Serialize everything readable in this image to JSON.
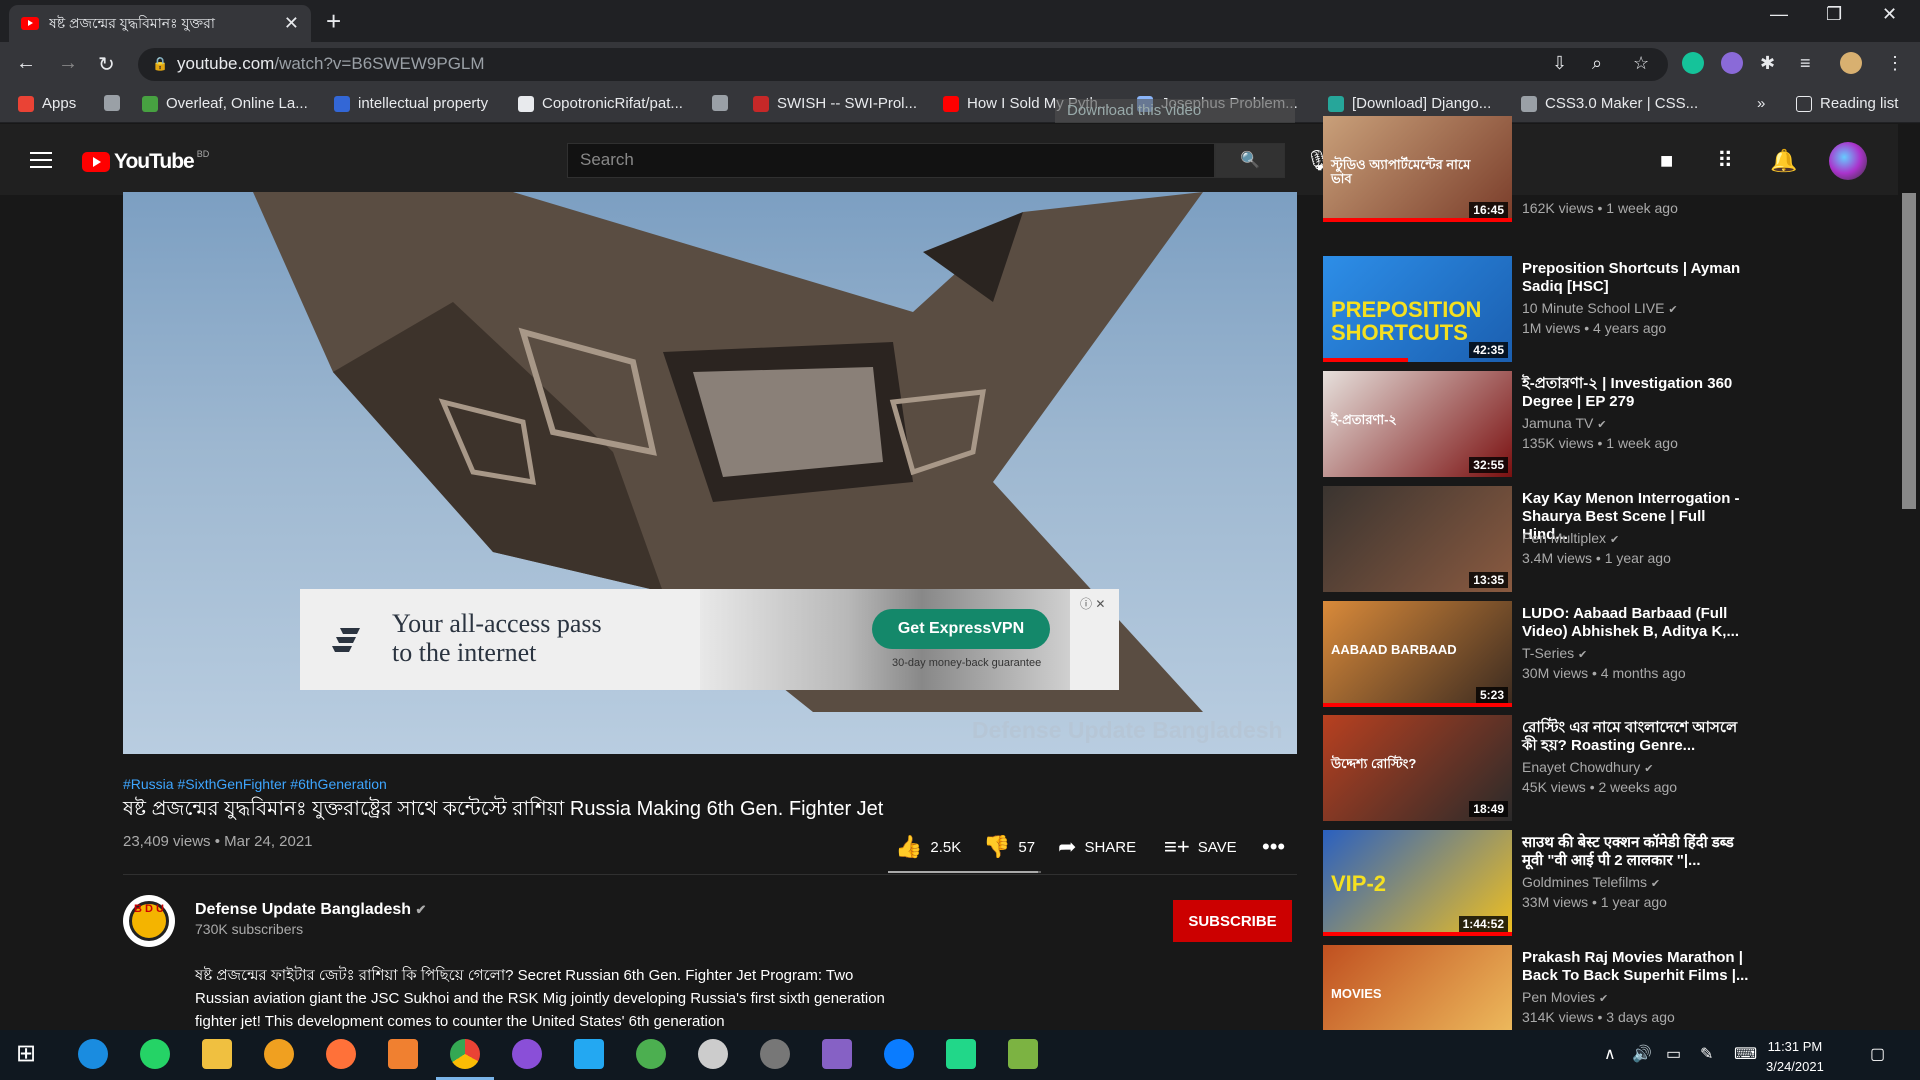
{
  "browser": {
    "tab_title": "ষষ্ট প্রজন্মের যুদ্ধবিমানঃ যুক্তরা",
    "url_host": "youtube.com",
    "url_path": "/watch?v=B6SWEW9PGLM",
    "bookmarks": [
      {
        "label": "Apps",
        "color": "#ea4335"
      },
      {
        "label": "",
        "color": "#9aa0a6"
      },
      {
        "label": "Overleaf, Online La...",
        "color": "#47a141"
      },
      {
        "label": "intellectual property",
        "color": "#3367d6"
      },
      {
        "label": "CopotronicRifat/pat...",
        "color": "#e8eaed"
      },
      {
        "label": "",
        "color": "#9aa0a6"
      },
      {
        "label": "SWISH -- SWI-Prol...",
        "color": "#c62828"
      },
      {
        "label": "How I Sold My Pyth...",
        "color": "#ff0000"
      },
      {
        "label": "Josephus Problem...",
        "color": "#8ab4f8"
      },
      {
        "label": "[Download] Django...",
        "color": "#26a69a"
      },
      {
        "label": "CSS3.0 Maker | CSS...",
        "color": "#9aa0a6"
      }
    ],
    "more": "»",
    "reading_list": "Reading list",
    "download_overlay": "Download this video"
  },
  "youtube": {
    "logo_text": "YouTube",
    "region": "BD",
    "search_placeholder": "Search"
  },
  "video": {
    "ad_line1": "Your all-access pass",
    "ad_line2": "to the internet",
    "ad_cta": "Get ExpressVPN",
    "ad_small": "30-day money-back guarantee",
    "watermark": "Defense Update Bangladesh",
    "tags": "#Russia #SixthGenFighter #6thGeneration",
    "title": "ষষ্ট প্রজন্মের যুদ্ধবিমানঃ যুক্তরাষ্ট্রের সাথে কন্টেস্টে রাশিয়া Russia Making 6th Gen. Fighter Jet",
    "views": "23,409 views • Mar 24, 2021",
    "likes": "2.5K",
    "dislikes": "57",
    "like_ratio": 0.978,
    "share": "SHARE",
    "save": "SAVE"
  },
  "channel": {
    "logo_text": "B D U",
    "name": "Defense Update Bangladesh",
    "subs": "730K subscribers",
    "subscribe": "SUBSCRIBE",
    "description": "ষষ্ট প্রজন্মের ফাইটার জেটঃ রাশিয়া কি পিছিয়ে গেলো? Secret Russian 6th Gen. Fighter Jet Program: Two Russian aviation giant the JSC Sukhoi and the RSK Mig jointly developing Russia's first sixth generation fighter jet! This development comes to counter the United States' 6th generation"
  },
  "recommended": [
    {
      "title": "",
      "channel": "",
      "meta": "162K views • 1 week ago",
      "duration": "16:45",
      "thumb_text": "স্টুডিও অ্যাপার্টমেন্টের নামে ভাব",
      "color1": "#c9a07a",
      "color2": "#7a3d2a",
      "progress": 1.0
    },
    {
      "title": "Preposition Shortcuts | Ayman Sadiq [HSC]",
      "channel": "10 Minute School LIVE",
      "meta": "1M views • 4 years ago",
      "duration": "42:35",
      "thumb_text": "PREPOSITION SHORTCUTS",
      "color1": "#2d8ee8",
      "color2": "#1b5fb0",
      "progress": 0.45
    },
    {
      "title": "ই-প্রতারণা-২ | Investigation 360 Degree | EP 279",
      "channel": "Jamuna TV",
      "meta": "135K views • 1 week ago",
      "duration": "32:55",
      "thumb_text": "ই-প্রতারণা-২",
      "color1": "#e6e0dc",
      "color2": "#7a1010",
      "progress": 0
    },
    {
      "title": "Kay Kay Menon Interrogation - Shaurya Best Scene | Full Hind...",
      "channel": "Pen Multiplex",
      "meta": "3.4M views • 1 year ago",
      "duration": "13:35",
      "thumb_text": "",
      "color1": "#3a3430",
      "color2": "#8a5a40",
      "progress": 0
    },
    {
      "title": "LUDO: Aabaad Barbaad (Full Video) Abhishek B, Aditya K,...",
      "channel": "T-Series",
      "meta": "30M views • 4 months ago",
      "duration": "5:23",
      "thumb_text": "AABAAD BARBAAD",
      "color1": "#d98a3a",
      "color2": "#3a2a20",
      "progress": 1.0
    },
    {
      "title": "রোস্টিং এর নামে বাংলাদেশে আসলে কী হয়? Roasting Genre...",
      "channel": "Enayet Chowdhury",
      "meta": "45K views • 2 weeks ago",
      "duration": "18:49",
      "thumb_text": "উদ্দেশ্য রোস্টিং?",
      "color1": "#b84020",
      "color2": "#2a2a2a",
      "progress": 0
    },
    {
      "title": "साउथ की बेस्ट एक्शन कॉमेडी हिंदी डब्ड मूवी \"वी आई पी 2 लालकार \"|...",
      "channel": "Goldmines Telefilms",
      "meta": "33M views • 1 year ago",
      "duration": "1:44:52",
      "thumb_text": "VIP-2",
      "color1": "#2a60c0",
      "color2": "#f0c020",
      "progress": 1.0
    },
    {
      "title": "Prakash Raj Movies Marathon | Back To Back Superhit Films |...",
      "channel": "Pen Movies",
      "meta": "314K views • 3 days ago",
      "duration": "",
      "thumb_text": "MOVIES",
      "color1": "#c05020",
      "color2": "#f0c060",
      "progress": 0
    }
  ],
  "taskbar": {
    "time": "11:31 PM",
    "date": "3/24/2021"
  }
}
